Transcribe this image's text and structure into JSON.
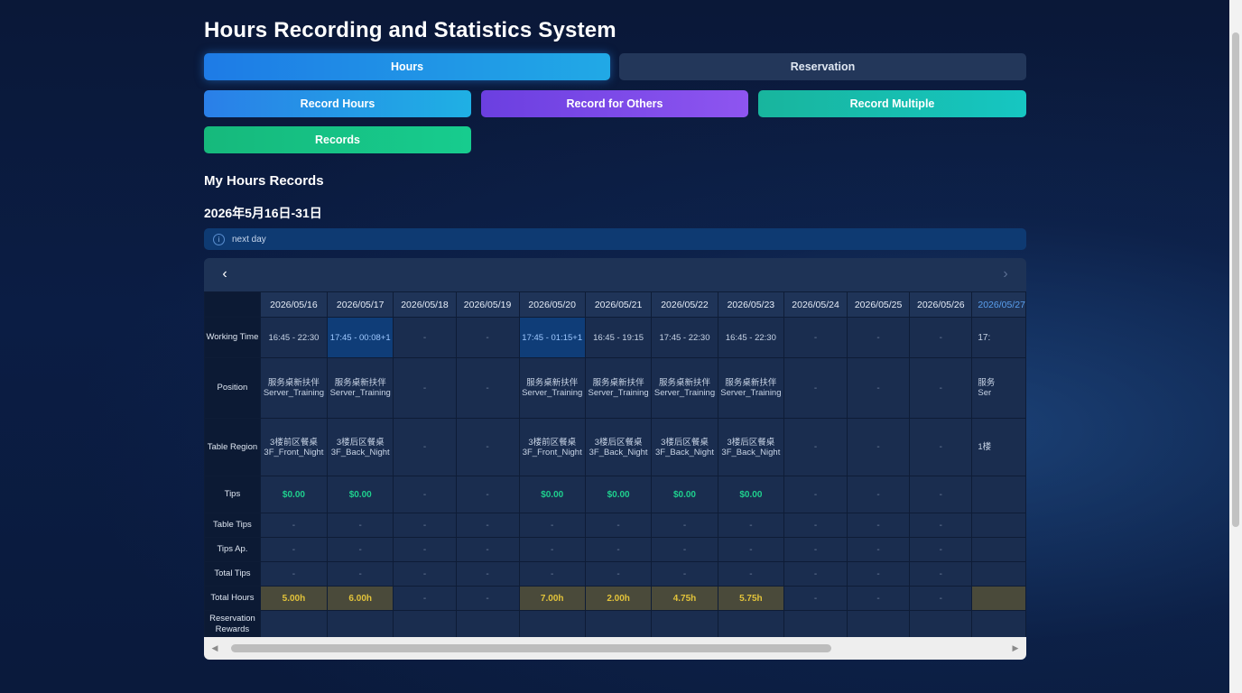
{
  "app": {
    "title": "Hours Recording and Statistics System"
  },
  "main_tabs": {
    "hours": "Hours",
    "reservation": "Reservation"
  },
  "actions": {
    "record_hours": "Record Hours",
    "record_for_others": "Record for Others",
    "record_multiple": "Record Multiple",
    "records": "Records"
  },
  "section": {
    "title": "My Hours Records",
    "period": "2026年5月16日-31日"
  },
  "notice": {
    "text": "next day"
  },
  "nav": {
    "prev": "‹",
    "next": "›"
  },
  "table": {
    "row_labels": [
      "Working Time",
      "Position",
      "Table Region",
      "Tips",
      "Table Tips",
      "Tips Ap.",
      "Total Tips",
      "Total Hours",
      "Reservation Rewards"
    ],
    "dates": [
      "2026/05/16",
      "2026/05/17",
      "2026/05/18",
      "2026/05/19",
      "2026/05/20",
      "2026/05/21",
      "2026/05/22",
      "2026/05/23",
      "2026/05/24",
      "2026/05/25",
      "2026/05/26"
    ],
    "working_time": [
      "16:45 - 22:30",
      "17:45 - 00:08+1",
      "-",
      "-",
      "17:45 - 01:15+1",
      "16:45 - 19:15",
      "17:45 - 22:30",
      "16:45 - 22:30",
      "-",
      "-",
      "-"
    ],
    "position_cn": [
      "服务桌新扶伴",
      "服务桌新扶伴",
      "-",
      "-",
      "服务桌新扶伴",
      "服务桌新扶伴",
      "服务桌新扶伴",
      "服务桌新扶伴",
      "-",
      "-",
      "-"
    ],
    "position_en": [
      "Server_Training",
      "Server_Training",
      "",
      "",
      "Server_Training",
      "Server_Training",
      "Server_Training",
      "Server_Training",
      "",
      "",
      ""
    ],
    "region_cn": [
      "3楼前区餐桌",
      "3楼后区餐桌",
      "-",
      "-",
      "3楼前区餐桌",
      "3楼后区餐桌",
      "3楼后区餐桌",
      "3楼后区餐桌",
      "-",
      "-",
      "-"
    ],
    "region_en": [
      "3F_Front_Night",
      "3F_Back_Night",
      "",
      "",
      "3F_Front_Night",
      "3F_Back_Night",
      "3F_Back_Night",
      "3F_Back_Night",
      "",
      "",
      ""
    ],
    "tips": [
      "$0.00",
      "$0.00",
      "-",
      "-",
      "$0.00",
      "$0.00",
      "$0.00",
      "$0.00",
      "-",
      "-",
      "-"
    ],
    "total_hours": [
      "5.00h",
      "6.00h",
      "-",
      "-",
      "7.00h",
      "2.00h",
      "4.75h",
      "5.75h",
      "-",
      "-",
      "-"
    ],
    "partial_col": {
      "date": "2026/05/27",
      "working_time": "17:",
      "position": "服务",
      "position_en": "Ser",
      "region": "1楼"
    }
  },
  "colors": {
    "hours_tab": "#1e7be6",
    "record_for_others": "#7b49e8",
    "record_multiple": "#16bdb0",
    "records": "#17c385",
    "tips_value": "#1fd08e",
    "total_hours_value": "#e2c33a"
  },
  "icons": {
    "notice": "info-icon",
    "prev": "chevron-left-icon",
    "next": "chevron-right-icon"
  }
}
